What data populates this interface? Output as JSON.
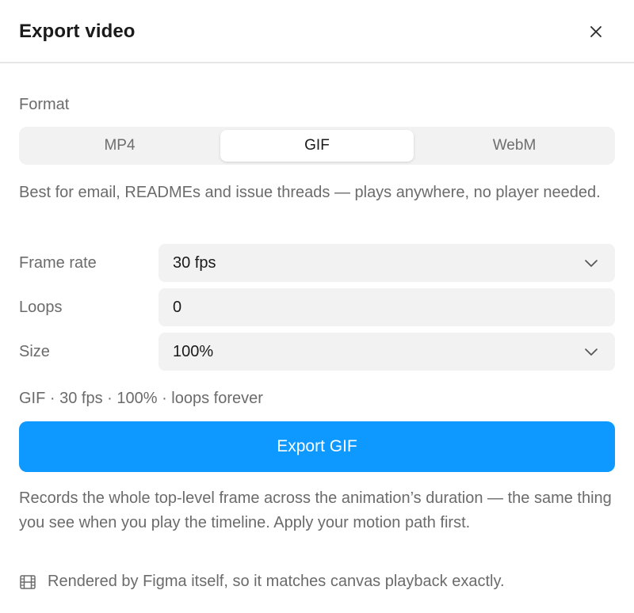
{
  "dialog": {
    "title": "Export video",
    "close_icon": "close-icon"
  },
  "format": {
    "label": "Format",
    "options": [
      "MP4",
      "GIF",
      "WebM"
    ],
    "selected": "GIF",
    "description": "Best for email, READMEs and issue threads — plays anywhere, no player needed."
  },
  "settings": {
    "frame_rate": {
      "label": "Frame rate",
      "value": "30 fps"
    },
    "loops": {
      "label": "Loops",
      "value": "0"
    },
    "size": {
      "label": "Size",
      "value": "100%"
    }
  },
  "summary": "GIF · 30 fps · 100% · loops forever",
  "export_button": {
    "label": "Export GIF",
    "color": "#0d99ff"
  },
  "note": "Records the whole top-level frame across the animation’s duration — the same thing you see when you play the timeline. Apply your motion path first.",
  "footer": {
    "icon": "film-icon",
    "text": "Rendered by Figma itself, so it matches canvas playback exactly."
  }
}
